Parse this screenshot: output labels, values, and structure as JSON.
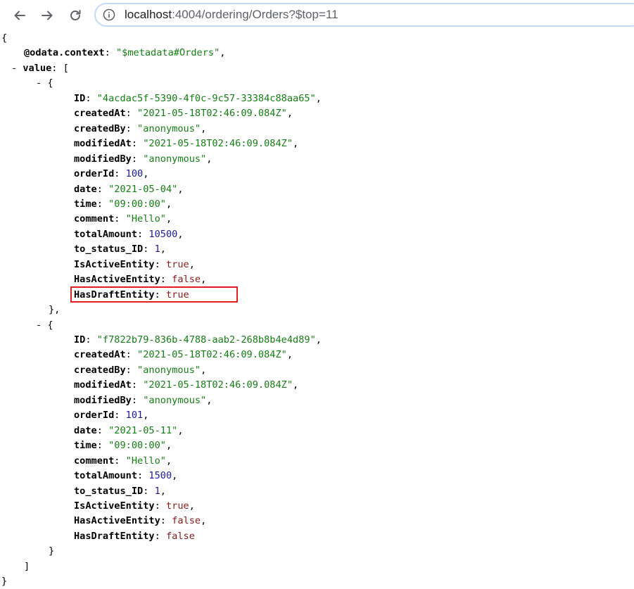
{
  "browser": {
    "url_host": "localhost",
    "url_path": ":4004/ordering/Orders?$top=11"
  },
  "json": {
    "open_brace": "{",
    "context_key": "@odata.context",
    "context_value": "\"$metadata#Orders\"",
    "value_toggle": "- ",
    "value_key": "value",
    "value_open": "[",
    "close_bracket": "]",
    "close_brace": "}",
    "records": [
      {
        "toggle": "- {",
        "close": "},",
        "fields": [
          {
            "key": "ID",
            "value": "\"4acdac5f-5390-4f0c-9c57-33384c88aa65\"",
            "type": "s",
            "sep": ","
          },
          {
            "key": "createdAt",
            "value": "\"2021-05-18T02:46:09.084Z\"",
            "type": "s",
            "sep": ","
          },
          {
            "key": "createdBy",
            "value": "\"anonymous\"",
            "type": "s",
            "sep": ","
          },
          {
            "key": "modifiedAt",
            "value": "\"2021-05-18T02:46:09.084Z\"",
            "type": "s",
            "sep": ","
          },
          {
            "key": "modifiedBy",
            "value": "\"anonymous\"",
            "type": "s",
            "sep": ","
          },
          {
            "key": "orderId",
            "value": "100",
            "type": "n",
            "sep": ","
          },
          {
            "key": "date",
            "value": "\"2021-05-04\"",
            "type": "s",
            "sep": ","
          },
          {
            "key": "time",
            "value": "\"09:00:00\"",
            "type": "s",
            "sep": ","
          },
          {
            "key": "comment",
            "value": "\"Hello\"",
            "type": "s",
            "sep": ","
          },
          {
            "key": "totalAmount",
            "value": "10500",
            "type": "n",
            "sep": ","
          },
          {
            "key": "to_status_ID",
            "value": "1",
            "type": "n",
            "sep": ","
          },
          {
            "key": "IsActiveEntity",
            "value": "true",
            "type": "b",
            "sep": ","
          },
          {
            "key": "HasActiveEntity",
            "value": "false",
            "type": "b",
            "sep": ","
          },
          {
            "key": "HasDraftEntity",
            "value": "true",
            "type": "b",
            "sep": ""
          }
        ]
      },
      {
        "toggle": "- {",
        "close": "}",
        "fields": [
          {
            "key": "ID",
            "value": "\"f7822b79-836b-4788-aab2-268b8b4e4d89\"",
            "type": "s",
            "sep": ","
          },
          {
            "key": "createdAt",
            "value": "\"2021-05-18T02:46:09.084Z\"",
            "type": "s",
            "sep": ","
          },
          {
            "key": "createdBy",
            "value": "\"anonymous\"",
            "type": "s",
            "sep": ","
          },
          {
            "key": "modifiedAt",
            "value": "\"2021-05-18T02:46:09.084Z\"",
            "type": "s",
            "sep": ","
          },
          {
            "key": "modifiedBy",
            "value": "\"anonymous\"",
            "type": "s",
            "sep": ","
          },
          {
            "key": "orderId",
            "value": "101",
            "type": "n",
            "sep": ","
          },
          {
            "key": "date",
            "value": "\"2021-05-11\"",
            "type": "s",
            "sep": ","
          },
          {
            "key": "time",
            "value": "\"09:00:00\"",
            "type": "s",
            "sep": ","
          },
          {
            "key": "comment",
            "value": "\"Hello\"",
            "type": "s",
            "sep": ","
          },
          {
            "key": "totalAmount",
            "value": "1500",
            "type": "n",
            "sep": ","
          },
          {
            "key": "to_status_ID",
            "value": "1",
            "type": "n",
            "sep": ","
          },
          {
            "key": "IsActiveEntity",
            "value": "true",
            "type": "b",
            "sep": ","
          },
          {
            "key": "HasActiveEntity",
            "value": "false",
            "type": "b",
            "sep": ","
          },
          {
            "key": "HasDraftEntity",
            "value": "false",
            "type": "b",
            "sep": ""
          }
        ]
      }
    ]
  },
  "colors": {
    "key": "#000000",
    "string": "#137f13",
    "number": "#1a1aa6",
    "boolean": "#8b1a1a",
    "highlight_border": "#e02020"
  },
  "icons": {
    "back": "arrow-left-icon",
    "forward": "arrow-right-icon",
    "reload": "reload-icon",
    "info": "info-icon"
  }
}
